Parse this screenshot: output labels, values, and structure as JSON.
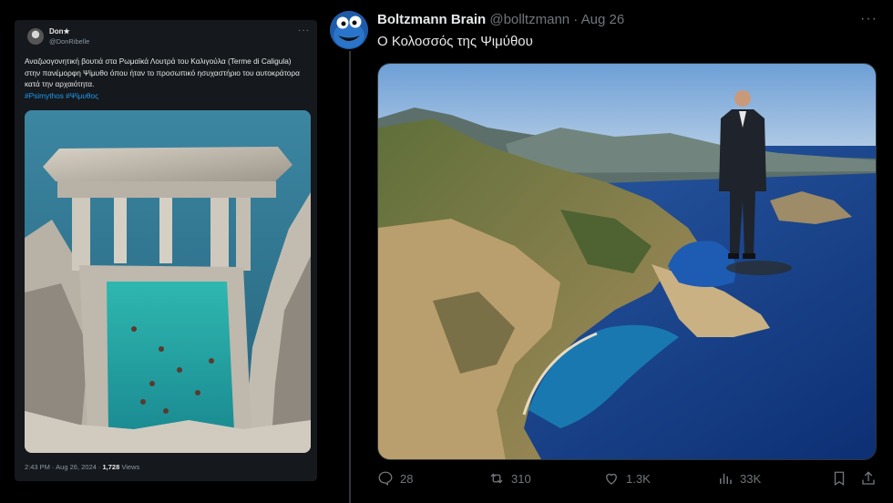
{
  "left_tweet": {
    "name": "Don★",
    "handle": "@DonRibelle",
    "text": "Αναζωογονητική βουτιά στα Ρωμαϊκά Λουτρά του Καλιγούλα (Terme di Caligula) στην πανέμορφη Ψίμυθο όπου ήταν το προσωπικό ησυχαστήριο του αυτοκράτορα κατά την αρχαιότητα.",
    "hashtags": "#Psimythos #Ψίμυθος",
    "timestamp": "2:43 PM · Aug 26, 2024 · ",
    "views_count": "1,728",
    "views_label": " Views"
  },
  "right_tweet": {
    "display_name": "Boltzmann Brain",
    "handle": "@bolltzmann",
    "separator": " · ",
    "date": "Aug 26",
    "text": "Ο Κολοσσός της Ψιμύθου",
    "actions": {
      "replies": "28",
      "retweets": "310",
      "likes": "1.3K",
      "views": "33K"
    }
  },
  "colors": {
    "background": "#000000",
    "text": "#e7e9ea",
    "muted": "#71767b",
    "link": "#1d9bf0",
    "card": "#15181c"
  }
}
